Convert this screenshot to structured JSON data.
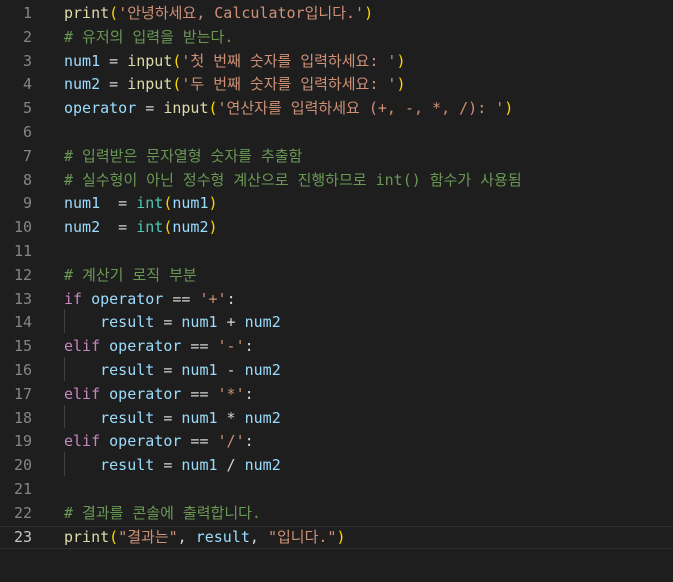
{
  "editor": {
    "active_line": "23",
    "lines": [
      {
        "no": "1",
        "t": [
          [
            "fn",
            "print"
          ],
          [
            "p1",
            "("
          ],
          [
            "str",
            "'안녕하세요, Calculator입니다.'"
          ],
          [
            "p1",
            ")"
          ]
        ]
      },
      {
        "no": "2",
        "t": [
          [
            "cmt",
            "# 유저의 입력을 받는다."
          ]
        ]
      },
      {
        "no": "3",
        "t": [
          [
            "var",
            "num1"
          ],
          [
            "op",
            " = "
          ],
          [
            "fn",
            "input"
          ],
          [
            "p1",
            "("
          ],
          [
            "str",
            "'첫 번째 숫자를 입력하세요: '"
          ],
          [
            "p1",
            ")"
          ]
        ]
      },
      {
        "no": "4",
        "t": [
          [
            "var",
            "num2"
          ],
          [
            "op",
            " = "
          ],
          [
            "fn",
            "input"
          ],
          [
            "p1",
            "("
          ],
          [
            "str",
            "'두 번째 숫자를 입력하세요: '"
          ],
          [
            "p1",
            ")"
          ]
        ]
      },
      {
        "no": "5",
        "t": [
          [
            "var",
            "operator"
          ],
          [
            "op",
            " = "
          ],
          [
            "fn",
            "input"
          ],
          [
            "p1",
            "("
          ],
          [
            "str",
            "'연산자를 입력하세요 (+, -, *, /): '"
          ],
          [
            "p1",
            ")"
          ]
        ]
      },
      {
        "no": "6",
        "t": []
      },
      {
        "no": "7",
        "t": [
          [
            "cmt",
            "# 입력받은 문자열형 숫자를 추출함"
          ]
        ]
      },
      {
        "no": "8",
        "t": [
          [
            "cmt",
            "# 실수형이 아닌 정수형 계산으로 진행하므로 int() 함수가 사용됨"
          ]
        ]
      },
      {
        "no": "9",
        "t": [
          [
            "var",
            "num1"
          ],
          [
            "op",
            "  = "
          ],
          [
            "cls",
            "int"
          ],
          [
            "p1",
            "("
          ],
          [
            "var",
            "num1"
          ],
          [
            "p1",
            ")"
          ]
        ]
      },
      {
        "no": "10",
        "t": [
          [
            "var",
            "num2"
          ],
          [
            "op",
            "  = "
          ],
          [
            "cls",
            "int"
          ],
          [
            "p1",
            "("
          ],
          [
            "var",
            "num2"
          ],
          [
            "p1",
            ")"
          ]
        ]
      },
      {
        "no": "11",
        "t": []
      },
      {
        "no": "12",
        "t": [
          [
            "cmt",
            "# 계산기 로직 부분"
          ]
        ]
      },
      {
        "no": "13",
        "t": [
          [
            "kw",
            "if"
          ],
          [
            "op",
            " "
          ],
          [
            "var",
            "operator"
          ],
          [
            "op",
            " == "
          ],
          [
            "str",
            "'+'"
          ],
          [
            "op",
            ":"
          ]
        ]
      },
      {
        "no": "14",
        "t": [
          [
            "op",
            "    "
          ],
          [
            "var",
            "result"
          ],
          [
            "op",
            " = "
          ],
          [
            "var",
            "num1"
          ],
          [
            "op",
            " + "
          ],
          [
            "var",
            "num2"
          ]
        ]
      },
      {
        "no": "15",
        "t": [
          [
            "kw",
            "elif"
          ],
          [
            "op",
            " "
          ],
          [
            "var",
            "operator"
          ],
          [
            "op",
            " == "
          ],
          [
            "str",
            "'-'"
          ],
          [
            "op",
            ":"
          ]
        ]
      },
      {
        "no": "16",
        "t": [
          [
            "op",
            "    "
          ],
          [
            "var",
            "result"
          ],
          [
            "op",
            " = "
          ],
          [
            "var",
            "num1"
          ],
          [
            "op",
            " - "
          ],
          [
            "var",
            "num2"
          ]
        ]
      },
      {
        "no": "17",
        "t": [
          [
            "kw",
            "elif"
          ],
          [
            "op",
            " "
          ],
          [
            "var",
            "operator"
          ],
          [
            "op",
            " == "
          ],
          [
            "str",
            "'*'"
          ],
          [
            "op",
            ":"
          ]
        ]
      },
      {
        "no": "18",
        "t": [
          [
            "op",
            "    "
          ],
          [
            "var",
            "result"
          ],
          [
            "op",
            " = "
          ],
          [
            "var",
            "num1"
          ],
          [
            "op",
            " * "
          ],
          [
            "var",
            "num2"
          ]
        ]
      },
      {
        "no": "19",
        "t": [
          [
            "kw",
            "elif"
          ],
          [
            "op",
            " "
          ],
          [
            "var",
            "operator"
          ],
          [
            "op",
            " == "
          ],
          [
            "str",
            "'/'"
          ],
          [
            "op",
            ":"
          ]
        ]
      },
      {
        "no": "20",
        "t": [
          [
            "op",
            "    "
          ],
          [
            "var",
            "result"
          ],
          [
            "op",
            " = "
          ],
          [
            "var",
            "num1"
          ],
          [
            "op",
            " / "
          ],
          [
            "var",
            "num2"
          ]
        ]
      },
      {
        "no": "21",
        "t": []
      },
      {
        "no": "22",
        "t": [
          [
            "cmt",
            "# 결과를 콘솔에 출력합니다."
          ]
        ]
      },
      {
        "no": "23",
        "t": [
          [
            "fn",
            "print"
          ],
          [
            "p1",
            "("
          ],
          [
            "str",
            "\"결과는\""
          ],
          [
            "op",
            ", "
          ],
          [
            "var",
            "result"
          ],
          [
            "op",
            ", "
          ],
          [
            "str",
            "\"입니다.\""
          ],
          [
            "p1",
            ")"
          ]
        ]
      }
    ]
  },
  "colors": {
    "background": "#1e1e1e",
    "comment": "#6a9955",
    "string": "#ce9178",
    "function": "#dcdcaa",
    "variable": "#9cdcfe",
    "keyword": "#c586c0",
    "builtin_class": "#4ec9b0",
    "bracket": "#ffd700",
    "line_number": "#858585"
  }
}
